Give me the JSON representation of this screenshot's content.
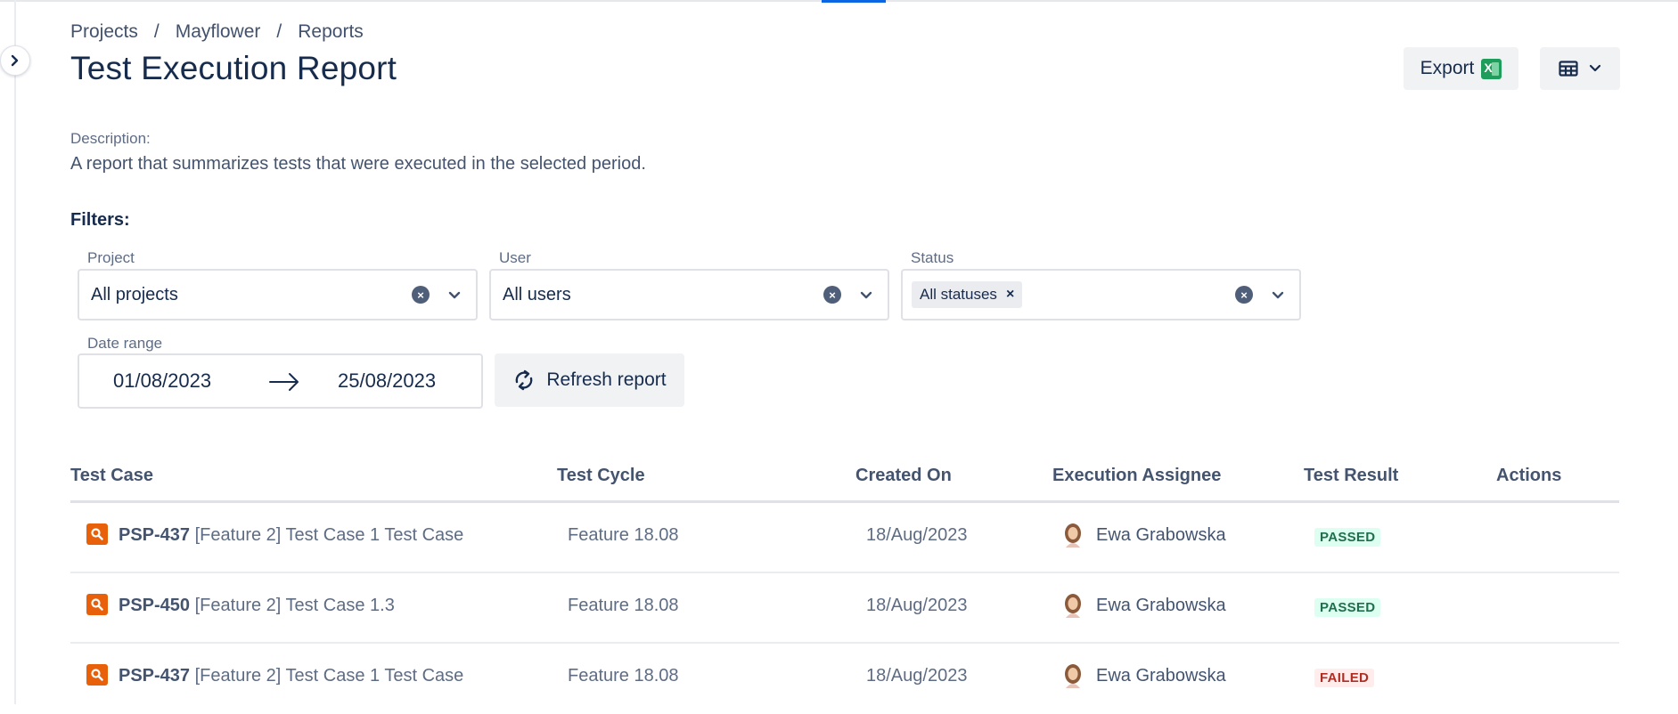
{
  "breadcrumb": [
    "Projects",
    "Mayflower",
    "Reports"
  ],
  "page": {
    "title": "Test Execution Report",
    "export_label": "Export",
    "description_label": "Description:",
    "description": "A report that summarizes tests that were executed in the selected period.",
    "filters_label": "Filters:"
  },
  "filters": {
    "project": {
      "label": "Project",
      "value": "All projects"
    },
    "user": {
      "label": "User",
      "value": "All users"
    },
    "status": {
      "label": "Status",
      "tag": "All statuses"
    },
    "date_range": {
      "label": "Date range",
      "from": "01/08/2023",
      "to": "25/08/2023"
    },
    "refresh_label": "Refresh report"
  },
  "table": {
    "columns": [
      "Test Case",
      "Test Cycle",
      "Created On",
      "Execution Assignee",
      "Test Result",
      "Actions"
    ],
    "rows": [
      {
        "key": "PSP-437",
        "name": "[Feature 2] Test Case 1 Test Case",
        "cycle": "Feature 18.08",
        "created": "18/Aug/2023",
        "assignee": "Ewa Grabowska",
        "result": "PASSED"
      },
      {
        "key": "PSP-450",
        "name": "[Feature 2] Test Case 1.3",
        "cycle": "Feature 18.08",
        "created": "18/Aug/2023",
        "assignee": "Ewa Grabowska",
        "result": "PASSED"
      },
      {
        "key": "PSP-437",
        "name": "[Feature 2] Test Case 1 Test Case",
        "cycle": "Feature 18.08",
        "created": "18/Aug/2023",
        "assignee": "Ewa Grabowska",
        "result": "FAILED"
      }
    ]
  },
  "colors": {
    "accent": "#0c66e4",
    "test_case_icon": "#e8600a",
    "passed_bg": "#dcfff1",
    "passed_text": "#216e4e",
    "failed_bg": "#ffeceb",
    "failed_text": "#ae2e24"
  },
  "icons": {
    "collapse": "chevron-right-icon",
    "export": "excel-icon",
    "view": "table-grid-icon",
    "refresh": "refresh-icon",
    "test_case": "search-icon"
  }
}
